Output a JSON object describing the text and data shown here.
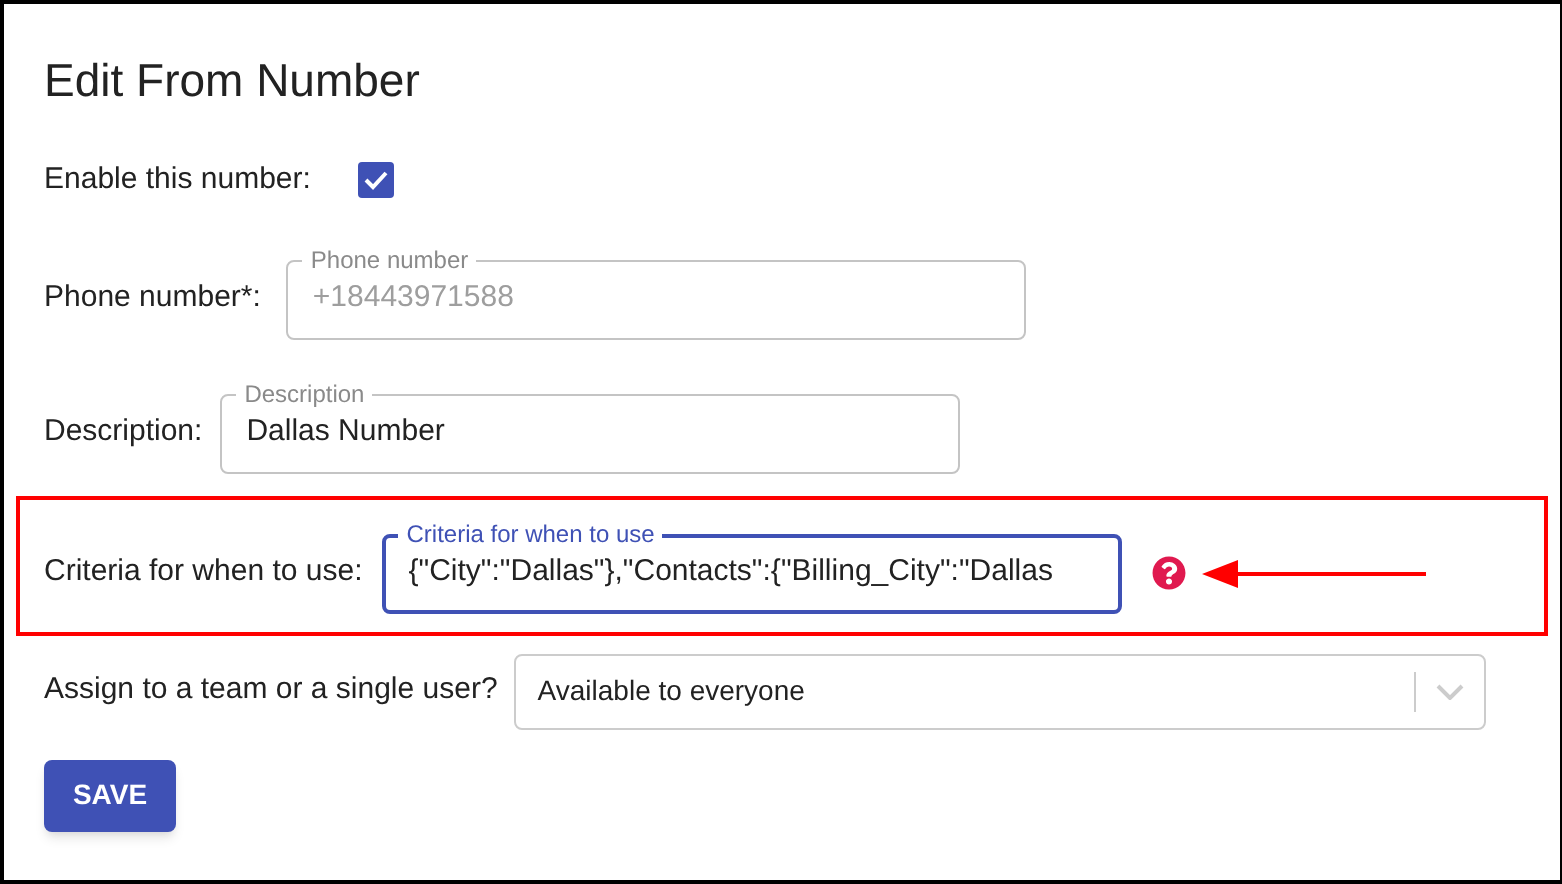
{
  "title": "Edit From Number",
  "enable": {
    "label": "Enable this number:",
    "checked": true
  },
  "fields": [
    {
      "label": "Phone number*:",
      "floating_label": "Phone number",
      "value": "+18443971588",
      "disabled": true,
      "focused": false
    },
    {
      "label": "Description:",
      "floating_label": "Description",
      "value": "Dallas Number",
      "disabled": false,
      "focused": false
    },
    {
      "label": "Criteria for when to use:",
      "floating_label": "Criteria for when to use",
      "value": "{\"City\":\"Dallas\"},\"Contacts\":{\"Billing_City\":\"Dallas",
      "disabled": false,
      "focused": true,
      "highlighted": true,
      "help": true
    }
  ],
  "assign": {
    "label": "Assign to a team or a single user?",
    "value": "Available to everyone"
  },
  "save": {
    "label": "SAVE"
  }
}
